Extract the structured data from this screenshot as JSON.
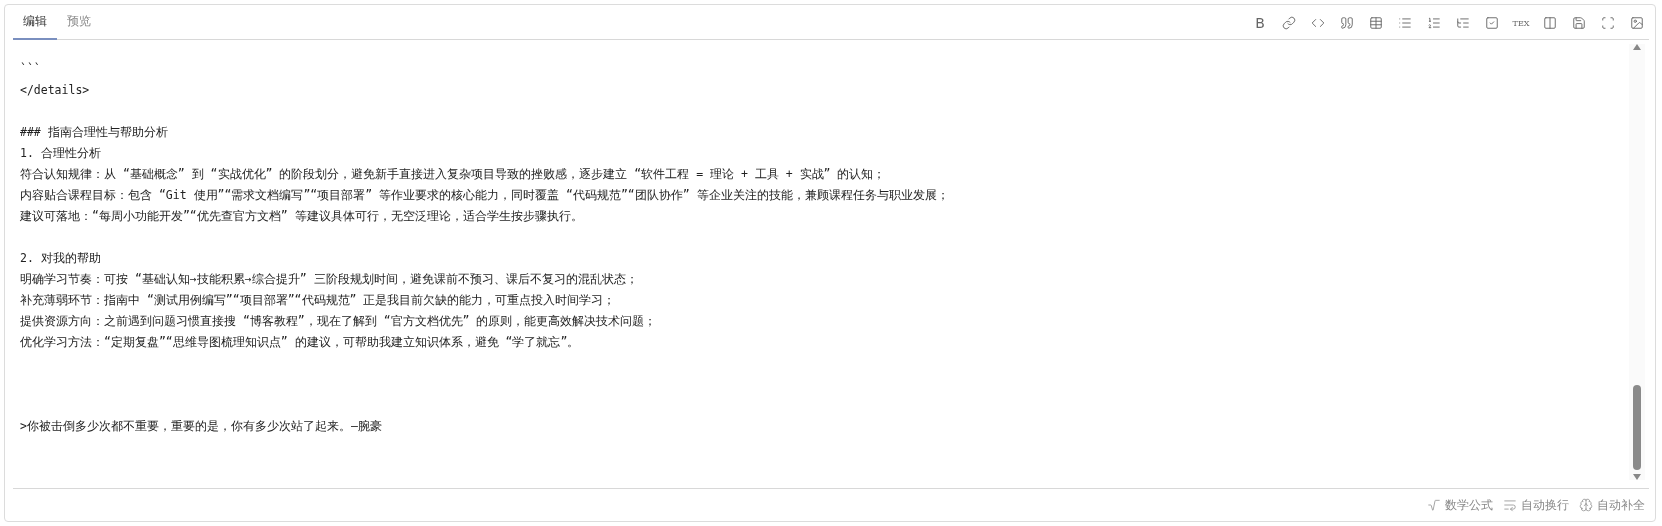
{
  "tabs": [
    {
      "label": "编辑",
      "selected": true
    },
    {
      "label": "预览",
      "selected": false
    }
  ],
  "toolbar": [
    {
      "kind": "bold",
      "label": "B"
    },
    {
      "kind": "link"
    },
    {
      "kind": "code"
    },
    {
      "kind": "quote"
    },
    {
      "kind": "table"
    },
    {
      "kind": "bullet-list"
    },
    {
      "kind": "numbered-list"
    },
    {
      "kind": "outline"
    },
    {
      "kind": "checkbox"
    },
    {
      "kind": "tex",
      "label": "TEX"
    },
    {
      "kind": "split"
    },
    {
      "kind": "save"
    },
    {
      "kind": "fullscreen"
    },
    {
      "kind": "image"
    }
  ],
  "editor": {
    "lines": [
      {
        "kind": "text",
        "text": "```"
      },
      {
        "kind": "text",
        "text": "</details>"
      },
      {
        "kind": "blank"
      },
      {
        "kind": "text",
        "text": "### 指南合理性与帮助分析"
      },
      {
        "kind": "text",
        "text": "1. 合理性分析"
      },
      {
        "kind": "text",
        "text": "符合认知规律：从 “基础概念” 到 “实战优化” 的阶段划分，避免新手直接进入复杂项目导致的挫败感，逐步建立 “软件工程 = 理论 + 工具 + 实战” 的认知；"
      },
      {
        "kind": "text",
        "text": "内容贴合课程目标：包含 “Git 使用”“需求文档编写”“项目部署” 等作业要求的核心能力，同时覆盖 “代码规范”“团队协作” 等企业关注的技能，兼顾课程任务与职业发展；"
      },
      {
        "kind": "text",
        "text": "建议可落地：“每周小功能开发”“优先查官方文档” 等建议具体可行，无空泛理论，适合学生按步骤执行。"
      },
      {
        "kind": "blank"
      },
      {
        "kind": "text",
        "text": "2. 对我的帮助"
      },
      {
        "kind": "text",
        "text": "明确学习节奏：可按 “基础认知→技能积累→综合提升” 三阶段规划时间，避免课前不预习、课后不复习的混乱状态；"
      },
      {
        "kind": "text",
        "text": "补充薄弱环节：指南中 “测试用例编写”“项目部署”“代码规范” 正是我目前欠缺的能力，可重点投入时间学习；"
      },
      {
        "kind": "text",
        "text": "提供资源方向：之前遇到问题习惯直接搜 “博客教程”，现在了解到 “官方文档优先” 的原则，能更高效解决技术问题；"
      },
      {
        "kind": "text",
        "text": "优化学习方法：“定期复盘”“思维导图梳理知识点” 的建议，可帮助我建立知识体系，避免 “学了就忘”。"
      },
      {
        "kind": "blank"
      },
      {
        "kind": "blank"
      },
      {
        "kind": "blank"
      },
      {
        "kind": "text",
        "text": ">你被击倒多少次都不重要，重要的是，你有多少次站了起来。—腕豪"
      }
    ]
  },
  "status_bar": [
    {
      "kind": "math",
      "label": "数学公式"
    },
    {
      "kind": "wrap",
      "label": "自动换行"
    },
    {
      "kind": "complete",
      "label": "自动补全"
    }
  ]
}
